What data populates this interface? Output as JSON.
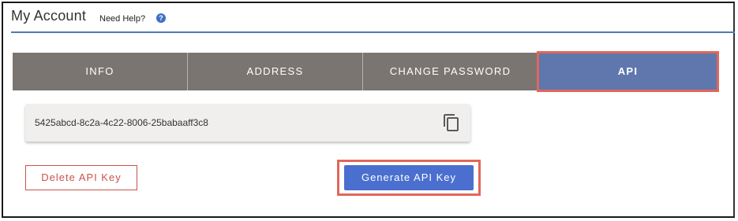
{
  "header": {
    "title": "My Account",
    "help_label": "Need Help?",
    "help_icon": "question-circle-icon",
    "help_glyph": "?"
  },
  "tabs": [
    {
      "label": "INFO",
      "active": false
    },
    {
      "label": "ADDRESS",
      "active": false
    },
    {
      "label": "CHANGE PASSWORD",
      "active": false
    },
    {
      "label": "API",
      "active": true
    }
  ],
  "api": {
    "key_value": "5425abcd-8c2a-4c22-8006-25babaaff3c8",
    "copy_icon": "copy-icon",
    "delete_label": "Delete API Key",
    "generate_label": "Generate API Key"
  },
  "colors": {
    "tab_bg": "#7b7572",
    "tab_active_bg": "#5f77ad",
    "highlight": "#e0675b",
    "primary_button": "#4a6fcf",
    "danger": "#c9534a",
    "header_rule": "#4f79b6"
  }
}
